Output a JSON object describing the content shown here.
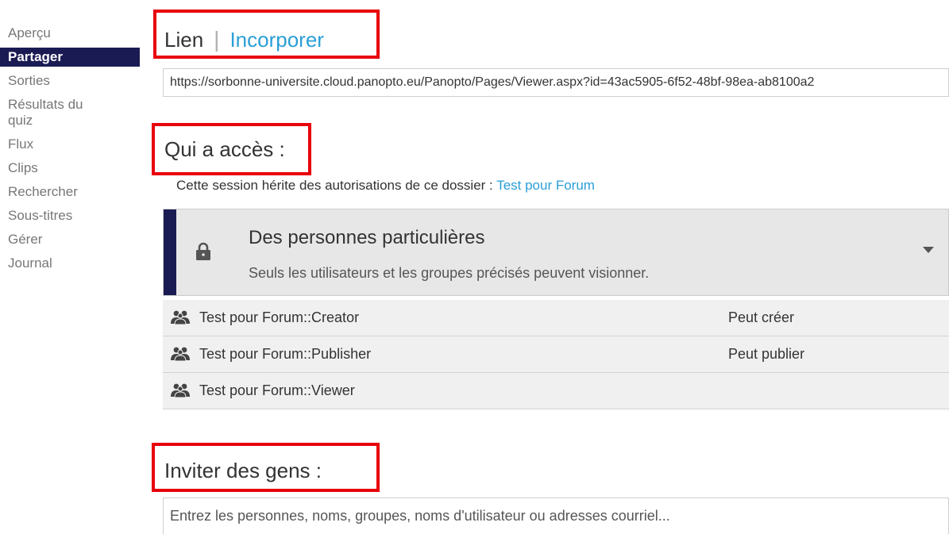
{
  "sidebar": {
    "items": [
      {
        "label": "Aperçu",
        "active": false
      },
      {
        "label": "Partager",
        "active": true
      },
      {
        "label": "Sorties",
        "active": false
      },
      {
        "label": "Résultats du quiz",
        "active": false
      },
      {
        "label": "Flux",
        "active": false
      },
      {
        "label": "Clips",
        "active": false
      },
      {
        "label": "Rechercher",
        "active": false
      },
      {
        "label": "Sous-titres",
        "active": false
      },
      {
        "label": "Gérer",
        "active": false
      },
      {
        "label": "Journal",
        "active": false
      }
    ]
  },
  "share": {
    "tab_link": "Lien",
    "tab_separator": "|",
    "tab_embed": "Incorporer",
    "url_value": "https://sorbonne-universite.cloud.panopto.eu/Panopto/Pages/Viewer.aspx?id=43ac5905-6f52-48bf-98ea-ab8100a2"
  },
  "access": {
    "heading": "Qui a accès :",
    "inherit_text": "Cette session hérite des autorisations de ce dossier : ",
    "inherit_folder": "Test pour Forum",
    "level_title": "Des personnes particulières",
    "level_description": "Seuls les utilisateurs et les groupes précisés peuvent visionner.",
    "lock_icon": "lock-icon",
    "dropdown_icon": "caret-down-icon",
    "permissions": [
      {
        "name": "Test pour Forum::Creator",
        "level": "Peut créer",
        "icon": "group-icon"
      },
      {
        "name": "Test pour Forum::Publisher",
        "level": "Peut publier",
        "icon": "group-icon"
      },
      {
        "name": "Test pour Forum::Viewer",
        "level": "",
        "icon": "group-icon"
      }
    ]
  },
  "invite": {
    "heading": "Inviter des gens :",
    "placeholder": "Entrez les personnes, noms, groupes, noms d'utilisateur ou adresses courriel..."
  },
  "colors": {
    "accent_navy": "#1b1b54",
    "link_blue": "#2b9fd6",
    "annotation_red": "#e8000b"
  }
}
